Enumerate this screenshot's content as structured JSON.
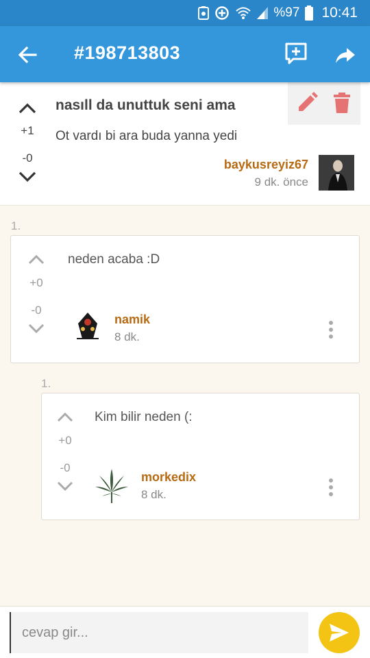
{
  "status_bar": {
    "battery": "%97",
    "time": "10:41"
  },
  "app_bar": {
    "title": "#198713803"
  },
  "post": {
    "title": "nasıll da unuttuk seni ama",
    "body": "Ot vardı bi ara buda yanna yedi",
    "upvotes": "+1",
    "downvotes": "-0",
    "author": "baykusreyiz67",
    "time": "9 dk. önce"
  },
  "comments": [
    {
      "index": "1.",
      "text": "neden acaba :D",
      "upvotes": "+0",
      "downvotes": "-0",
      "author": "namik",
      "time": "8 dk."
    },
    {
      "index": "1.",
      "text": "Kim bilir neden (:",
      "upvotes": "+0",
      "downvotes": "-0",
      "author": "morkedix",
      "time": "8 dk."
    }
  ],
  "reply": {
    "placeholder": "cevap gir..."
  },
  "colors": {
    "status_bar": "#2a86c8",
    "app_bar": "#3597db",
    "author": "#b86a12",
    "delete": "#e57373",
    "send": "#f4c414",
    "background": "#fbf7ee"
  },
  "icons": {
    "back": "arrow-left-icon",
    "add_comment": "add-comment-icon",
    "share": "share-icon",
    "edit": "pencil-icon",
    "delete": "trash-icon",
    "upvote": "chevron-up-icon",
    "downvote": "chevron-down-icon",
    "more": "more-vert-icon",
    "send": "send-icon"
  }
}
